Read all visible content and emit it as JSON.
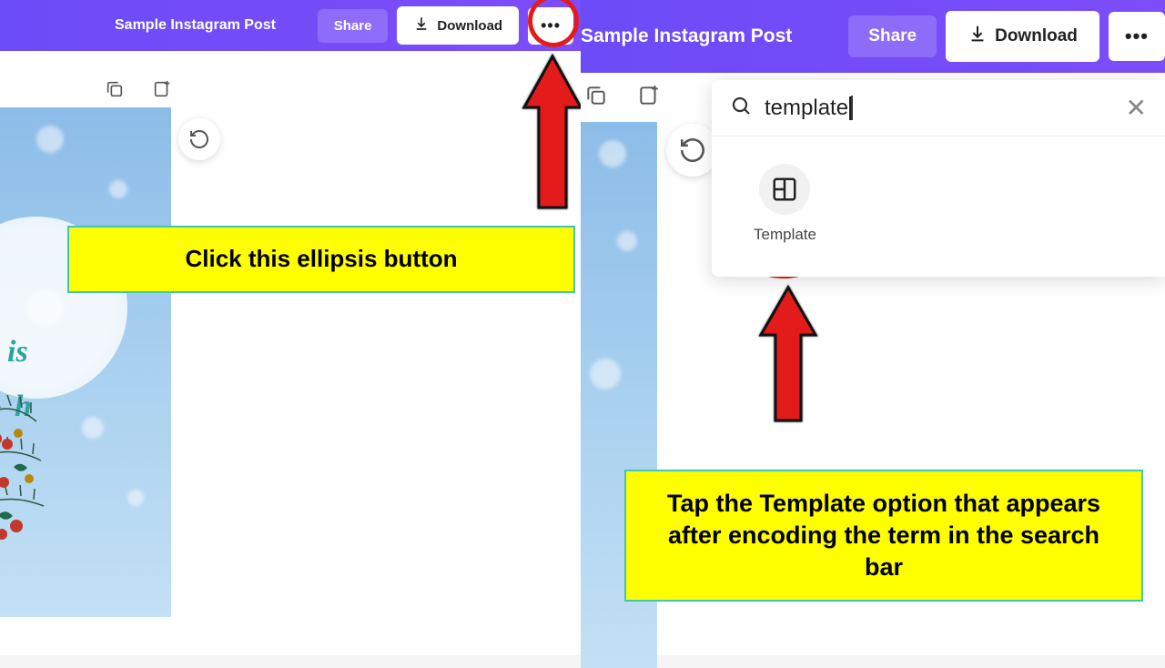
{
  "left": {
    "doc_title": "Sample Instagram Post",
    "share": "Share",
    "download": "Download",
    "canvas_text1": "is",
    "canvas_text2": "h",
    "callout": "Click this ellipsis button"
  },
  "right": {
    "doc_title": "Sample Instagram Post",
    "share": "Share",
    "download": "Download",
    "search_value": "template",
    "result_label": "Template",
    "callout": "Tap the Template option that appears after encoding the term in the search bar"
  }
}
